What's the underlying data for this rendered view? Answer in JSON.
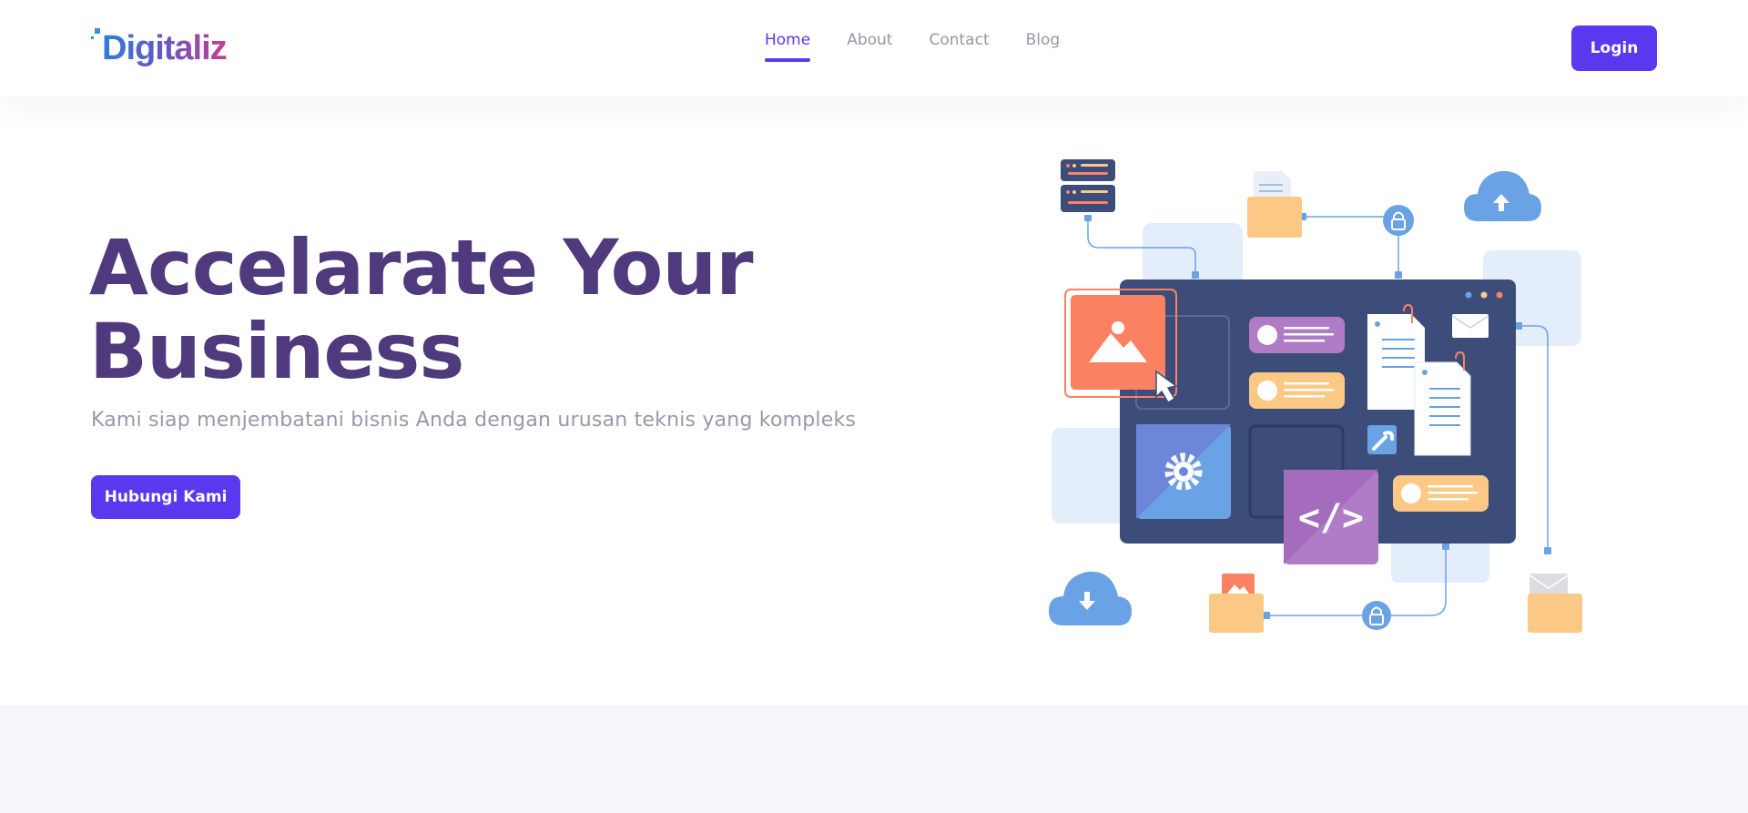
{
  "brand": {
    "name": "Digitaliz",
    "logo_colors": [
      "#2f7ed6",
      "#5e5bc7",
      "#c33e92"
    ]
  },
  "nav": {
    "items": [
      {
        "label": "Home",
        "active": true
      },
      {
        "label": "About",
        "active": false
      },
      {
        "label": "Contact",
        "active": false
      },
      {
        "label": "Blog",
        "active": false
      }
    ],
    "login_label": "Login"
  },
  "hero": {
    "title_line1": "Accelarate Your",
    "title_line2": "Business",
    "subtitle": "Kami siap menjembatani bisnis Anda dengan urusan teknis yang kompleks",
    "cta_label": "Hubungi Kami"
  },
  "illustration": {
    "icons": [
      "server-icon",
      "document-folder-icon",
      "lock-icon",
      "cloud-upload-icon",
      "cloud-download-icon",
      "image-icon",
      "cursor-icon",
      "settings-icon",
      "code-icon",
      "wrench-icon",
      "mail-icon"
    ],
    "code_symbol": "</>"
  },
  "colors": {
    "accent": "#5a38f0",
    "title": "#4f3a7e",
    "muted_text": "#9a98a8",
    "panel": "#3d4d7a",
    "light_blue": "#e4edfa",
    "blue": "#6aa2e6",
    "orange": "#fa8262",
    "purple": "#b07cc7",
    "yellow": "#fbc985"
  }
}
